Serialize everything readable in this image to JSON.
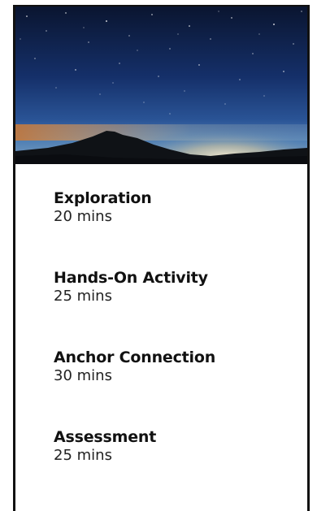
{
  "hero": {
    "image": "night-sky-mountain-silhouette",
    "colors": {
      "sky_top": "#0a1530",
      "sky_mid": "#1c3f7a",
      "horizon_glow": "#e8d9b0",
      "horizon_orange": "#d68a3c",
      "mountain": "#111418"
    }
  },
  "activities": [
    {
      "title": "Exploration",
      "duration": "20 mins"
    },
    {
      "title": "Hands-On Activity",
      "duration": "25 mins"
    },
    {
      "title": "Anchor Connection",
      "duration": "30 mins"
    },
    {
      "title": "Assessment",
      "duration": "25 mins"
    }
  ]
}
